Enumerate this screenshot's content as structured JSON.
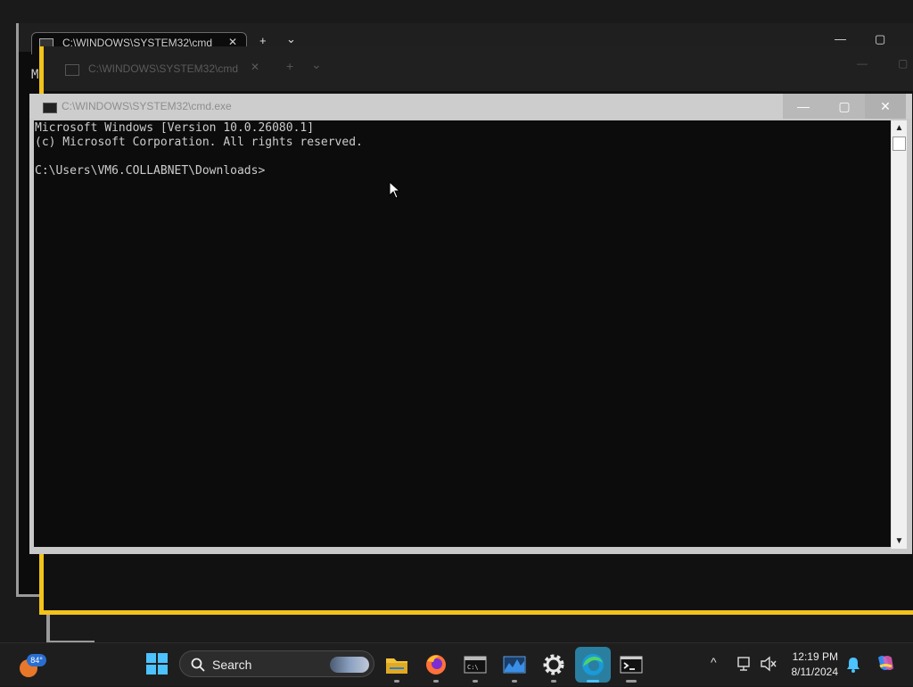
{
  "background_windows": {
    "tab1_title": "C:\\WINDOWS\\SYSTEM32\\cmd",
    "tab1_close": "✕",
    "new_tab": "+",
    "tab_dropdown": "⌄",
    "minimize": "—",
    "maximize": "▢",
    "letter": "M",
    "tab2_title": "C:\\WINDOWS\\SYSTEM32\\cmd",
    "tab2_close": "✕"
  },
  "cmd_window": {
    "title": "C:\\WINDOWS\\SYSTEM32\\cmd.exe",
    "minimize": "—",
    "maximize": "▢",
    "close": "✕",
    "lines": [
      "Microsoft Windows [Version 10.0.26080.1]",
      "(c) Microsoft Corporation. All rights reserved.",
      "",
      "C:\\Users\\VM6.COLLABNET\\Downloads>"
    ],
    "scroll_up": "▲",
    "scroll_down": "▼"
  },
  "taskbar": {
    "weather_temp": "84°",
    "search_label": "Search",
    "apps": [
      {
        "name": "file-explorer-icon",
        "color": "#f3c23b"
      },
      {
        "name": "firefox-icon",
        "color": "#ff7139"
      },
      {
        "name": "command-prompt-icon",
        "color": "#2b2b2b"
      },
      {
        "name": "task-manager-icon",
        "color": "#3a8ee6"
      },
      {
        "name": "settings-icon",
        "color": "#cfcfcf"
      },
      {
        "name": "edge-icon",
        "color": "#1a9ad8"
      },
      {
        "name": "terminal-icon",
        "color": "#2b2b2b"
      }
    ],
    "tray_chevron": "^",
    "time": "12:19 PM",
    "date": "8/11/2024"
  },
  "colors": {
    "accent_yellow": "#f2c31a",
    "console_bg": "#0c0c0c",
    "console_text": "#cccccc",
    "start_blue": "#4cc2ff"
  }
}
